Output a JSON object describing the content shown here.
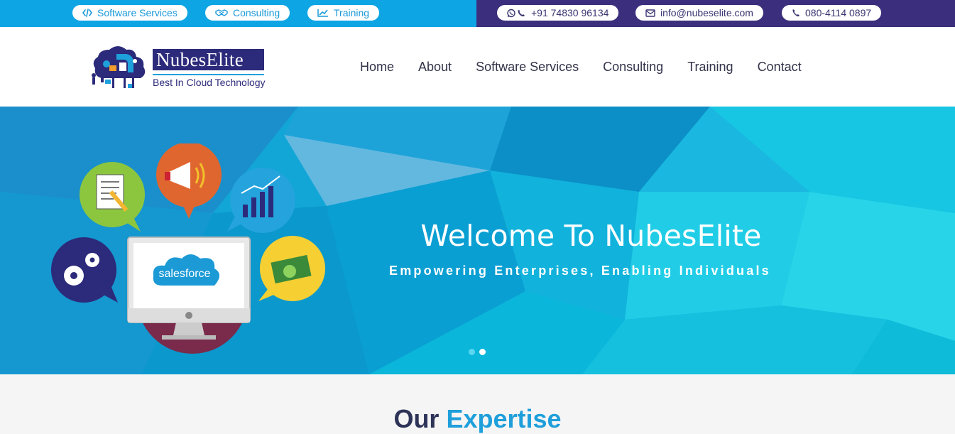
{
  "topbar": {
    "links": [
      {
        "label": "Software Services",
        "icon": "code-icon"
      },
      {
        "label": "Consulting",
        "icon": "handshake-icon"
      },
      {
        "label": "Training",
        "icon": "chart-line-icon"
      }
    ],
    "contacts": [
      {
        "label": "+91 74830 96134",
        "icon": "whatsapp-phone-icon"
      },
      {
        "label": "info@nubeselite.com",
        "icon": "envelope-icon"
      },
      {
        "label": "080-4114 0897",
        "icon": "phone-icon"
      }
    ],
    "colors": {
      "left": "#0ea5e4",
      "right": "#3b2f7d"
    }
  },
  "logo": {
    "name": "NubesElite",
    "name_part1": "Nubes",
    "name_part2": "Elite",
    "tagline": "Best In Cloud Technology"
  },
  "nav": {
    "items": [
      "Home",
      "About",
      "Software Services",
      "Consulting",
      "Training",
      "Contact"
    ]
  },
  "hero": {
    "title": "Welcome To NubesElite",
    "subtitle": "Empowering Enterprises, Enabling Individuals",
    "illustration_label": "salesforce",
    "slide_count": 2,
    "active_slide": 2
  },
  "expertise": {
    "heading_part1": "Our",
    "heading_part2": "Expertise"
  }
}
